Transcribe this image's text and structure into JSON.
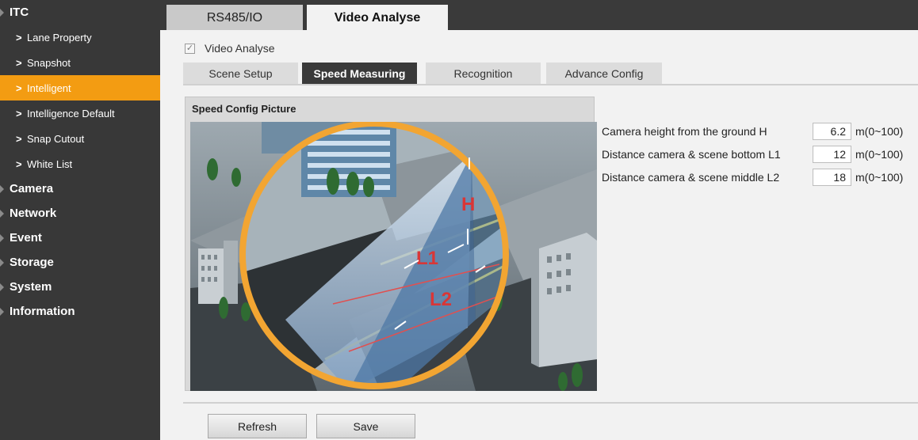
{
  "sidebar": {
    "title": "ITC",
    "sub_items": [
      {
        "label": "Lane Property",
        "active": false
      },
      {
        "label": "Snapshot",
        "active": false
      },
      {
        "label": "Intelligent",
        "active": true
      },
      {
        "label": "Intelligence Default",
        "active": false
      },
      {
        "label": "Snap Cutout",
        "active": false
      },
      {
        "label": "White List",
        "active": false
      }
    ],
    "categories": [
      "Camera",
      "Network",
      "Event",
      "Storage",
      "System",
      "Information"
    ],
    "active_color": "#f39c12"
  },
  "top_tabs": [
    {
      "label": "RS485/IO",
      "active": false
    },
    {
      "label": "Video Analyse",
      "active": true
    }
  ],
  "video_analyse": {
    "label": "Video Analyse",
    "checked": true
  },
  "sub_tabs": [
    {
      "label": "Scene Setup",
      "active": false
    },
    {
      "label": "Speed Measuring",
      "active": true
    },
    {
      "label": "Recognition",
      "active": false
    },
    {
      "label": "Advance Config",
      "active": false
    }
  ],
  "picture_panel": {
    "title": "Speed Config Picture",
    "labels": {
      "h": "H",
      "l1": "L1",
      "l2": "L2"
    }
  },
  "params": [
    {
      "label": "Camera height from the ground H",
      "value": "6.2",
      "unit": "m(0~100)"
    },
    {
      "label": "Distance camera & scene bottom L1",
      "value": "12",
      "unit": "m(0~100)"
    },
    {
      "label": "Distance camera & scene middle L2",
      "value": "18",
      "unit": "m(0~100)"
    }
  ],
  "buttons": {
    "refresh": "Refresh",
    "save": "Save"
  }
}
